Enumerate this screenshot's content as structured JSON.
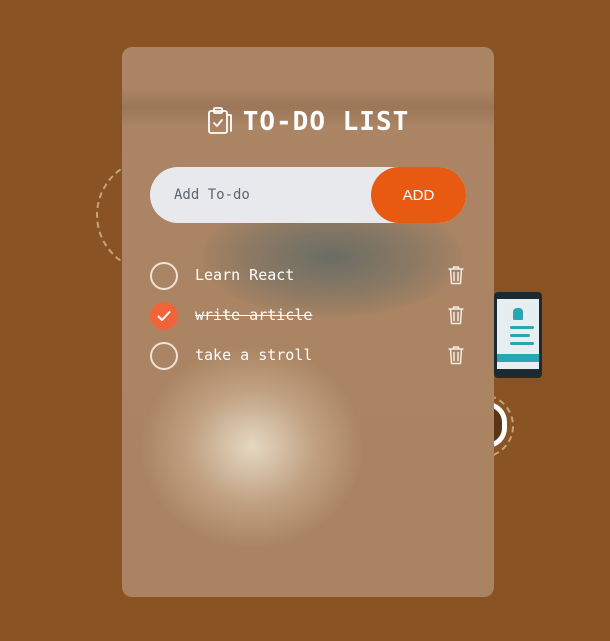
{
  "app": {
    "title": "TO-DO LIST"
  },
  "input": {
    "placeholder": "Add To-do",
    "value": ""
  },
  "add_button": {
    "label": "ADD"
  },
  "colors": {
    "background": "#8a5323",
    "accent": "#e85a12",
    "check_done": "#f0643a"
  },
  "todos": [
    {
      "text": "Learn React",
      "done": false
    },
    {
      "text": "write article",
      "done": true
    },
    {
      "text": "take a stroll",
      "done": false
    }
  ],
  "icons": {
    "title": "clipboard-check-icon",
    "delete": "trash-icon",
    "checked": "checkmark-icon"
  }
}
